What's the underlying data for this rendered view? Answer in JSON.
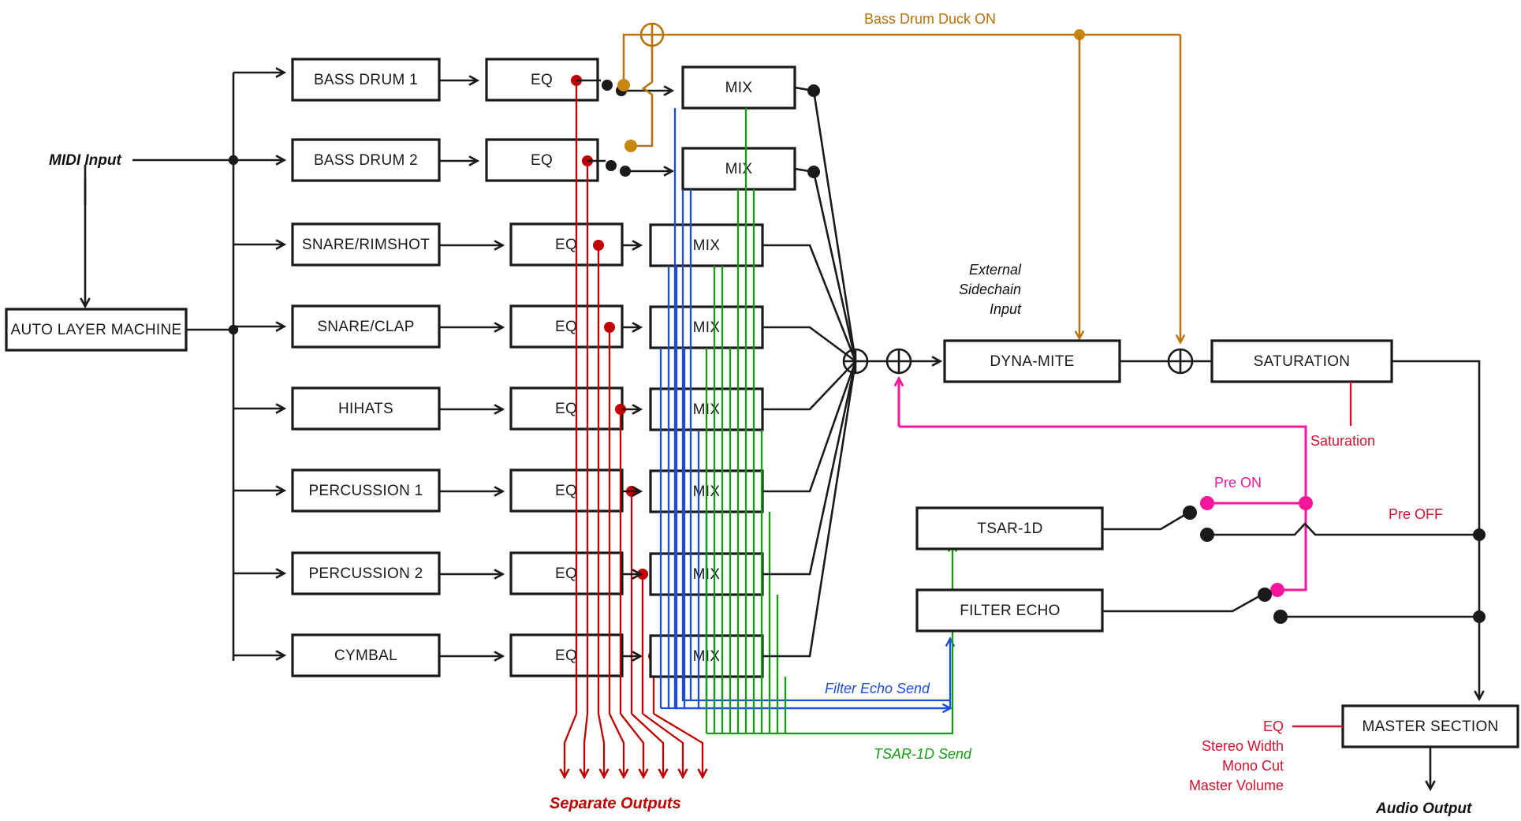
{
  "diagram": {
    "title": "Drum Machine Signal Flow",
    "inputs": {
      "midi_input": "MIDI Input",
      "auto_layer_machine": "AUTO LAYER MACHINE"
    },
    "channels": [
      {
        "name": "BASS DRUM 1",
        "eq": "EQ",
        "mix": "MIX"
      },
      {
        "name": "BASS DRUM 2",
        "eq": "EQ",
        "mix": "MIX"
      },
      {
        "name": "SNARE/RIMSHOT",
        "eq": "EQ",
        "mix": "MIX"
      },
      {
        "name": "SNARE/CLAP",
        "eq": "EQ",
        "mix": "MIX"
      },
      {
        "name": "HIHATS",
        "eq": "EQ",
        "mix": "MIX"
      },
      {
        "name": "PERCUSSION 1",
        "eq": "EQ",
        "mix": "MIX"
      },
      {
        "name": "PERCUSSION 2",
        "eq": "EQ",
        "mix": "MIX"
      },
      {
        "name": "CYMBAL",
        "eq": "EQ",
        "mix": "MIX"
      }
    ],
    "master_chain": {
      "dynamite": "DYNA-MITE",
      "saturation": "SATURATION",
      "master_section": "MASTER SECTION",
      "audio_output": "Audio Output"
    },
    "effects": {
      "tsar": "TSAR-1D",
      "filter_echo": "FILTER ECHO"
    },
    "labels": {
      "bass_drum_duck": "Bass Drum Duck ON",
      "external_sidechain_1": "External",
      "external_sidechain_2": "Sidechain",
      "external_sidechain_3": "Input",
      "saturation_ctrl": "Saturation",
      "pre_on": "Pre ON",
      "pre_off": "Pre OFF",
      "filter_echo_send": "Filter Echo Send",
      "tsar_send": "TSAR-1D Send",
      "separate_outputs": "Separate Outputs"
    },
    "master_controls": [
      "EQ",
      "Stereo Width",
      "Mono Cut",
      "Master Volume"
    ],
    "colors": {
      "black": "#1a1a1a",
      "separate_outputs_red": "#c00000",
      "duck_orange": "#b8730b",
      "filter_echo_blue": "#1b4ddb",
      "tsar_green": "#12a012",
      "pre_pink": "#f5169b",
      "master_red": "#d81030"
    }
  }
}
